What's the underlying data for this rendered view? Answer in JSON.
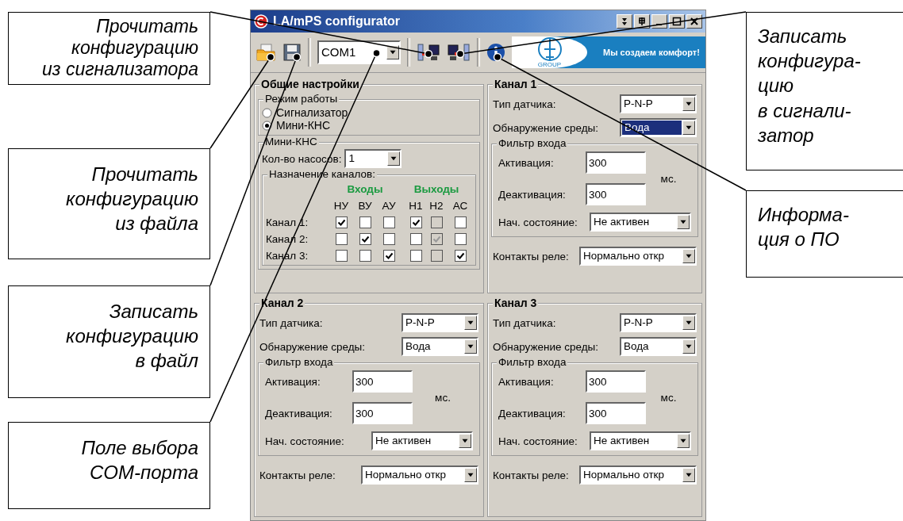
{
  "callouts_left": [
    {
      "text": "Прочитать\nконфигурацию\nиз сигнализатора"
    },
    {
      "text": "Прочитать\nконфигурацию\nиз файла"
    },
    {
      "text": "Записать\nконфигурацию\nв файл"
    },
    {
      "text": "Поле выбора\nCOM-порта"
    }
  ],
  "callouts_right": [
    {
      "text": "Записать\nконфигура-\nцию\nв сигнали-\nзатор"
    },
    {
      "text": "Информа-\nция о ПО"
    }
  ],
  "window": {
    "title": "LA/mPS configurator"
  },
  "toolbar": {
    "port": "COM1",
    "logo_caption": "GROUP",
    "slogan": "Мы создаем комфорт!"
  },
  "general": {
    "title": "Общие настройки",
    "mode": {
      "title": "Режим работы",
      "options": [
        {
          "label": "Сигнализатор",
          "selected": false
        },
        {
          "label": "Мини-КНС",
          "selected": true
        }
      ]
    },
    "kns": {
      "title": "Мини-КНС",
      "pumps_label": "Кол-во насосов:",
      "pumps": "1",
      "assign": {
        "title": "Назначение каналов:",
        "groups": [
          {
            "label": "Входы",
            "columns": [
              "НУ",
              "ВУ",
              "АУ"
            ]
          },
          {
            "label": "Выходы",
            "columns": [
              "Н1",
              "Н2",
              "АС"
            ]
          }
        ],
        "rows": [
          {
            "label": "Канал 1:",
            "cells": [
              {
                "checked": true,
                "disabled": false
              },
              {
                "checked": false,
                "disabled": false
              },
              {
                "checked": false,
                "disabled": false
              },
              {
                "checked": true,
                "disabled": false
              },
              {
                "checked": false,
                "disabled": true
              },
              {
                "checked": false,
                "disabled": false
              }
            ]
          },
          {
            "label": "Канал 2:",
            "cells": [
              {
                "checked": false,
                "disabled": false
              },
              {
                "checked": true,
                "disabled": false
              },
              {
                "checked": false,
                "disabled": false
              },
              {
                "checked": false,
                "disabled": false
              },
              {
                "checked": true,
                "disabled": true
              },
              {
                "checked": false,
                "disabled": false
              }
            ]
          },
          {
            "label": "Канал 3:",
            "cells": [
              {
                "checked": false,
                "disabled": false
              },
              {
                "checked": false,
                "disabled": false
              },
              {
                "checked": true,
                "disabled": false
              },
              {
                "checked": false,
                "disabled": false
              },
              {
                "checked": false,
                "disabled": true
              },
              {
                "checked": true,
                "disabled": false
              }
            ]
          }
        ]
      }
    }
  },
  "channels": [
    {
      "title": "Канал 1",
      "sensor_label": "Тип датчика:",
      "sensor": "P-N-P",
      "medium_label": "Обнаружение среды:",
      "medium": "Вода",
      "medium_highlighted": true,
      "filter_title": "Фильтр входа",
      "activation_label": "Активация:",
      "activation": "300",
      "unit": "мс.",
      "deactivation_label": "Деактивация:",
      "deactivation": "300",
      "state_label": "Нач. состояние:",
      "state": "Не активен",
      "relay_label": "Контакты реле:",
      "relay": "Нормально откр"
    },
    {
      "title": "Канал 2",
      "sensor_label": "Тип датчика:",
      "sensor": "P-N-P",
      "medium_label": "Обнаружение среды:",
      "medium": "Вода",
      "medium_highlighted": false,
      "filter_title": "Фильтр входа",
      "activation_label": "Активация:",
      "activation": "300",
      "unit": "мс.",
      "deactivation_label": "Деактивация:",
      "deactivation": "300",
      "state_label": "Нач. состояние:",
      "state": "Не активен",
      "relay_label": "Контакты реле:",
      "relay": "Нормально откр"
    },
    {
      "title": "Канал 3",
      "sensor_label": "Тип датчика:",
      "sensor": "P-N-P",
      "medium_label": "Обнаружение среды:",
      "medium": "Вода",
      "medium_highlighted": false,
      "filter_title": "Фильтр входа",
      "activation_label": "Активация:",
      "activation": "300",
      "unit": "мс.",
      "deactivation_label": "Деактивация:",
      "deactivation": "300",
      "state_label": "Нач. состояние:",
      "state": "Не активен",
      "relay_label": "Контакты реле:",
      "relay": "Нормально откр"
    }
  ]
}
